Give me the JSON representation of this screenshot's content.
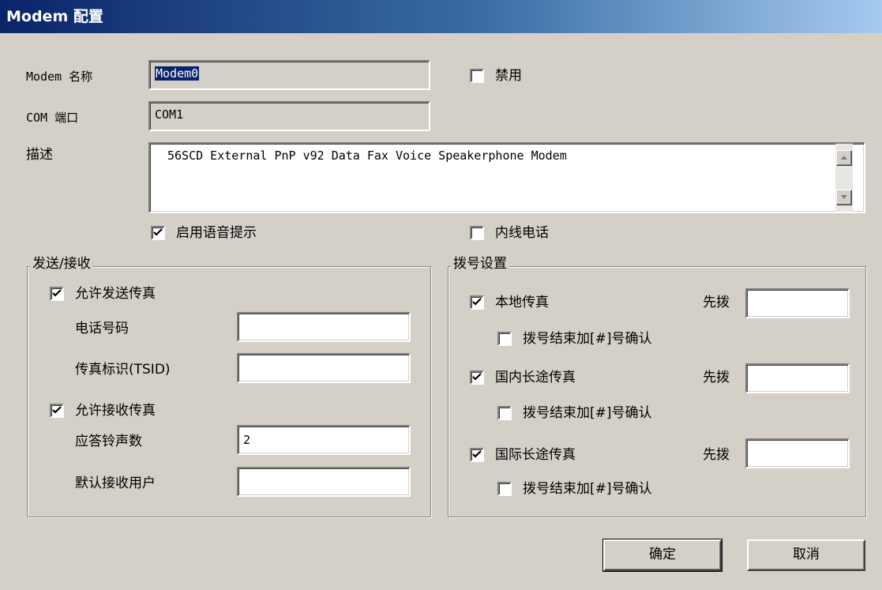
{
  "window": {
    "title": "Modem 配置"
  },
  "modem_name": {
    "label": "Modem 名称",
    "value": "Modem0"
  },
  "com_port": {
    "label": "COM 端口",
    "value": "COM1"
  },
  "disable": {
    "label": "禁用",
    "checked": false
  },
  "description": {
    "label": "描述",
    "value": "56SCD External PnP v92 Data Fax Voice Speakerphone Modem"
  },
  "voice_prompt": {
    "label": "启用语音提示",
    "checked": true
  },
  "internal_phone": {
    "label": "内线电话",
    "checked": false
  },
  "send_receive": {
    "title": "发送/接收",
    "allow_send": {
      "label": "允许发送传真",
      "checked": true
    },
    "phone_number": {
      "label": "电话号码",
      "value": ""
    },
    "tsid": {
      "label": "传真标识(TSID)",
      "value": ""
    },
    "allow_receive": {
      "label": "允许接收传真",
      "checked": true
    },
    "ring_count": {
      "label": "应答铃声数",
      "value": "2"
    },
    "default_user": {
      "label": "默认接收用户",
      "value": ""
    }
  },
  "dial_settings": {
    "title": "拨号设置",
    "local_fax": {
      "label": "本地传真",
      "checked": true,
      "prefix_label": "先拨",
      "prefix_value": "",
      "confirm_label": "拨号结束加[#]号确认",
      "confirm_checked": false
    },
    "domestic_fax": {
      "label": "国内长途传真",
      "checked": true,
      "prefix_label": "先拨",
      "prefix_value": "",
      "confirm_label": "拨号结束加[#]号确认",
      "confirm_checked": false
    },
    "international_fax": {
      "label": "国际长途传真",
      "checked": true,
      "prefix_label": "先拨",
      "prefix_value": "",
      "confirm_label": "拨号结束加[#]号确认",
      "confirm_checked": false
    }
  },
  "buttons": {
    "ok": "确定",
    "cancel": "取消"
  },
  "colors": {
    "title_start": "#0a246a",
    "title_end": "#a6caf0",
    "face": "#d4d0c8",
    "selection": "#0a246a"
  }
}
